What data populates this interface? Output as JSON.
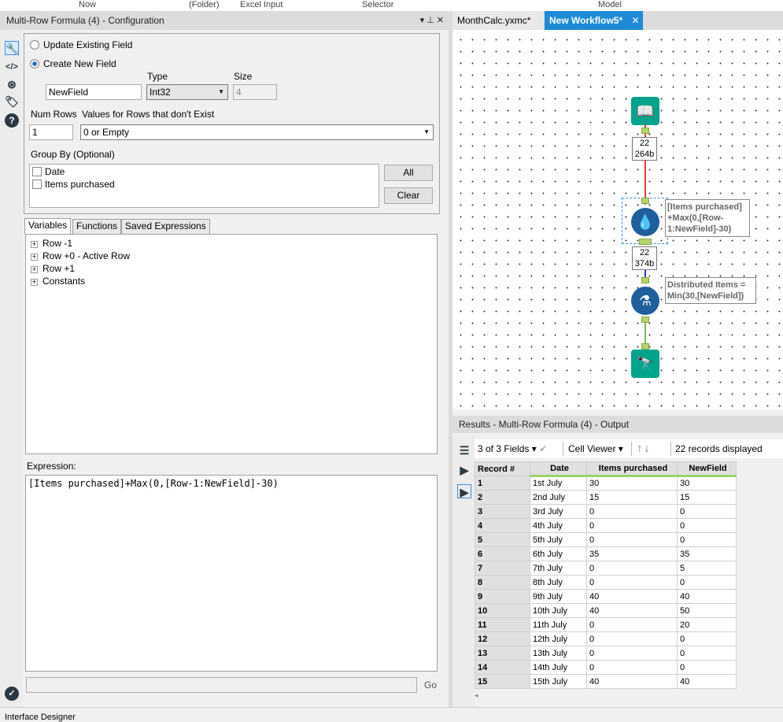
{
  "toolbar_labels": [
    "Now",
    "(Folder)",
    "Excel Input",
    "Selector",
    "Model"
  ],
  "config": {
    "title": "Multi-Row Formula (4) - Configuration",
    "update_existing": "Update Existing Field",
    "create_new": "Create New  Field",
    "type_label": "Type",
    "size_label": "Size",
    "field_name": "NewField",
    "type_value": "Int32",
    "size_value": "4",
    "num_rows_label": "Num Rows",
    "num_rows": "1",
    "nonexist_label": "Values for Rows that don't Exist",
    "nonexist_value": "0 or Empty",
    "group_by_label": "Group By (Optional)",
    "group_fields": [
      "Date",
      "Items purchased"
    ],
    "all_button": "All",
    "clear_button": "Clear",
    "tabs": [
      "Variables",
      "Functions",
      "Saved Expressions"
    ],
    "tree": [
      "Row -1",
      "Row +0 - Active Row",
      "Row +1",
      "Constants"
    ],
    "expression_label": "Expression:",
    "expression": "[Items purchased]+Max(0,[Row-1:NewField]-30)",
    "go": "Go"
  },
  "workflow": {
    "tabs": [
      "MonthCalc.yxmc*",
      "New Workflow5*"
    ],
    "count1": [
      "22",
      "264b"
    ],
    "count2": [
      "22",
      "374b"
    ],
    "annotation1": "[Items purchased] +Max(0,[Row-1:NewField]-30)",
    "annotation2": "Distributed Items = Min(30,[NewField])",
    "colors": {
      "input": "#00a38b",
      "multirow": "#1f5f9c",
      "formula": "#1f5f9c",
      "browse": "#00a38b",
      "connector_red": "#e23b3b",
      "connector_blue": "#3030d0",
      "connector_green": "#7dba6a"
    }
  },
  "results": {
    "title": "Results - Multi-Row Formula (4) - Output",
    "fields": "3 of 3 Fields",
    "viewer": "Cell Viewer",
    "records": "22 records displayed",
    "columns": [
      "Record #",
      "Date",
      "Items purchased",
      "NewField"
    ],
    "rows": [
      [
        "1",
        "1st July",
        "30",
        "30"
      ],
      [
        "2",
        "2nd July",
        "15",
        "15"
      ],
      [
        "3",
        "3rd July",
        "0",
        "0"
      ],
      [
        "4",
        "4th July",
        "0",
        "0"
      ],
      [
        "5",
        "5th July",
        "0",
        "0"
      ],
      [
        "6",
        "6th July",
        "35",
        "35"
      ],
      [
        "7",
        "7th July",
        "0",
        "5"
      ],
      [
        "8",
        "8th July",
        "0",
        "0"
      ],
      [
        "9",
        "9th July",
        "40",
        "40"
      ],
      [
        "10",
        "10th July",
        "40",
        "50"
      ],
      [
        "11",
        "11th July",
        "0",
        "20"
      ],
      [
        "12",
        "12th July",
        "0",
        "0"
      ],
      [
        "13",
        "13th July",
        "0",
        "0"
      ],
      [
        "14",
        "14th July",
        "0",
        "0"
      ],
      [
        "15",
        "15th July",
        "40",
        "40"
      ]
    ]
  },
  "status": "Interface Designer"
}
